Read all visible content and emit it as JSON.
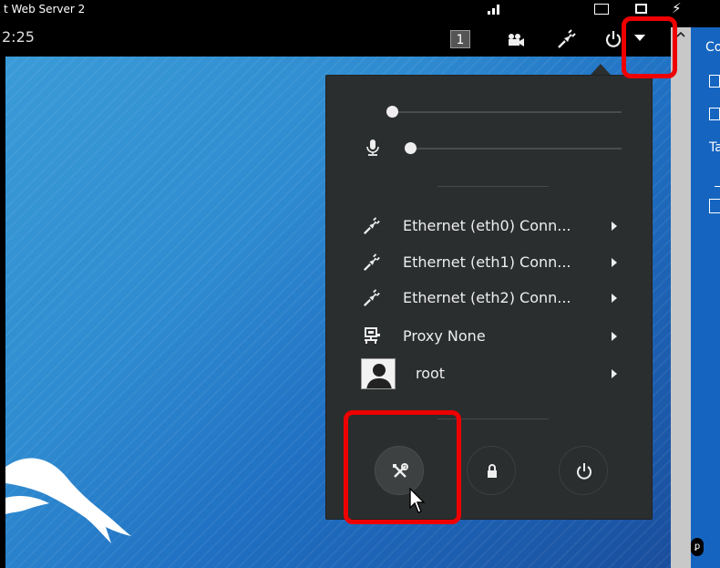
{
  "window": {
    "title": "t Web Server 2"
  },
  "topbar": {
    "clock": "2:25",
    "workspace_number": "1"
  },
  "right_panel": {
    "header_fragment": "Co",
    "tab_fragment": "Ta"
  },
  "system_menu": {
    "volume_level": 0,
    "mic_level": 0,
    "network_items": [
      {
        "label": "Ethernet (eth0) Conn...",
        "icon": "network-wired-icon"
      },
      {
        "label": "Ethernet (eth1) Conn...",
        "icon": "network-wired-icon"
      },
      {
        "label": "Ethernet (eth2) Conn...",
        "icon": "network-wired-icon"
      }
    ],
    "proxy": {
      "label": "Proxy None",
      "icon": "proxy-icon"
    },
    "user": {
      "label": "root",
      "icon": "avatar-icon"
    },
    "actions": [
      {
        "name": "settings",
        "icon": "settings-tools-icon"
      },
      {
        "name": "lock",
        "icon": "lock-icon"
      },
      {
        "name": "power-off",
        "icon": "power-icon"
      }
    ]
  },
  "colors": {
    "popup_bg": "#2b2e2f",
    "highlight": "#ee0000",
    "desktop_blue": "#2f8bd0"
  }
}
